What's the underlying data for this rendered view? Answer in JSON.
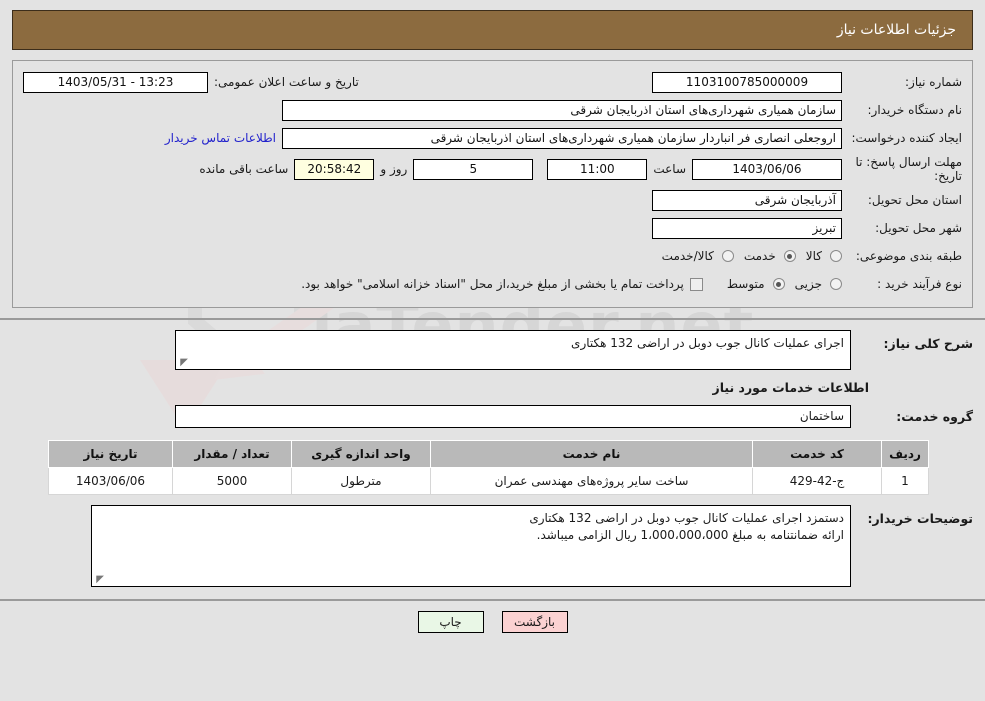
{
  "header": {
    "title": "جزئیات اطلاعات نیاز"
  },
  "form": {
    "need_no_label": "شماره نیاز:",
    "need_no_value": "1103100785000009",
    "public_announce_label": "تاریخ و ساعت اعلان عمومی:",
    "public_announce_value": "13:23 - 1403/05/31",
    "buyer_org_label": "نام دستگاه خریدار:",
    "buyer_org_value": "سازمان همیاری شهرداری‌های استان اذربایجان شرقی",
    "creator_label": "ایجاد کننده درخواست:",
    "creator_value": "اروجعلی انصاری فر انباردار سازمان همیاری شهرداری‌های استان اذربایجان شرقی",
    "contact_link": "اطلاعات تماس خریدار",
    "deadline_label": "مهلت ارسال پاسخ: تا تاریخ:",
    "deadline_date": "1403/06/06",
    "deadline_hour_label": "ساعت",
    "deadline_hour_value": "11:00",
    "remaining_days": "5",
    "remaining_days_suffix": "روز و",
    "remaining_hms": "20:58:42",
    "remaining_suffix": "ساعت باقی مانده",
    "province_label": "استان محل تحویل:",
    "province_value": "آذربایجان شرقی",
    "city_label": "شهر محل تحویل:",
    "city_value": "تبریز",
    "category_label": "طبقه بندی موضوعی:",
    "category_options": [
      {
        "label": "کالا",
        "selected": false
      },
      {
        "label": "خدمت",
        "selected": true
      },
      {
        "label": "کالا/خدمت",
        "selected": false
      }
    ],
    "process_label": "نوع فرآیند خرید :",
    "process_options": [
      {
        "label": "جزیی",
        "selected": false
      },
      {
        "label": "متوسط",
        "selected": true
      }
    ],
    "treasury_checkbox_label": "پرداخت تمام یا بخشی از مبلغ خرید،از محل \"اسناد خزانه اسلامی\" خواهد بود.",
    "treasury_checked": false
  },
  "body": {
    "need_desc_label": "شرح کلی نیاز:",
    "need_desc_value": "اجرای عملیات کانال جوب دوبل در اراضی 132 هکتاری",
    "services_heading": "اطلاعات خدمات مورد نیاز",
    "service_group_label": "گروه خدمت:",
    "service_group_value": "ساختمان",
    "buyer_notes_label": "توضیحات خریدار:",
    "buyer_notes_value": "دستمزد اجرای عملیات کانال جوب دوبل در اراضی 132 هکتاری\nارائه ضمانتنامه به مبلغ 1،000،000،000 ریال الزامی میباشد."
  },
  "table": {
    "columns": [
      "ردیف",
      "کد خدمت",
      "نام خدمت",
      "واحد اندازه گیری",
      "تعداد / مقدار",
      "تاریخ نیاز"
    ],
    "rows": [
      {
        "index": "1",
        "code": "ج-42-429",
        "name": "ساخت سایر پروژه‌های مهندسی عمران",
        "unit": "مترطول",
        "qty": "5000",
        "date": "1403/06/06"
      }
    ]
  },
  "footer": {
    "print_label": "چاپ",
    "back_label": "بازگشت"
  },
  "watermark": {
    "text": "AriaTender.net"
  },
  "colors": {
    "header_bg": "#8c6b3f",
    "header_text": "#ffffff",
    "link": "#2222cc",
    "table_header_bg": "#b9b9b9",
    "countdown_bg": "#ffffe0",
    "print_btn_bg": "#e9f7e6",
    "back_btn_bg": "#fbd2d2",
    "page_bg": "#e3e3e3"
  }
}
